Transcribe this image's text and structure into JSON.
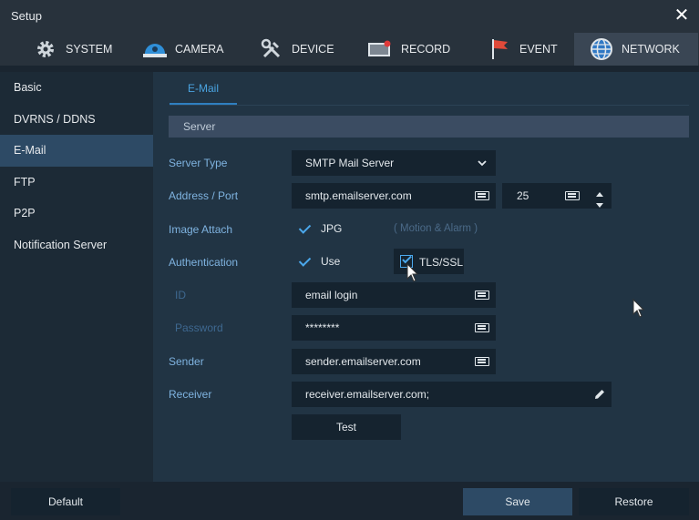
{
  "window": {
    "title": "Setup",
    "close_glyph": "✕"
  },
  "tabs": [
    {
      "label": "SYSTEM",
      "icon": "gear-icon"
    },
    {
      "label": "CAMERA",
      "icon": "camera-icon"
    },
    {
      "label": "DEVICE",
      "icon": "tools-icon"
    },
    {
      "label": "RECORD",
      "icon": "record-icon"
    },
    {
      "label": "EVENT",
      "icon": "flag-icon"
    },
    {
      "label": "NETWORK",
      "icon": "globe-icon"
    }
  ],
  "sidebar": {
    "items": [
      {
        "label": "Basic"
      },
      {
        "label": "DVRNS / DDNS"
      },
      {
        "label": "E-Mail"
      },
      {
        "label": "FTP"
      },
      {
        "label": "P2P"
      },
      {
        "label": "Notification Server"
      }
    ]
  },
  "subtab": {
    "label": "E-Mail"
  },
  "section": {
    "title": "Server"
  },
  "form": {
    "server_type": {
      "label": "Server Type",
      "value": "SMTP Mail Server"
    },
    "address_port": {
      "label": "Address / Port",
      "address": "smtp.emailserver.com",
      "port": "25"
    },
    "image_attach": {
      "label": "Image Attach",
      "option": "JPG",
      "note": "( Motion & Alarm )"
    },
    "authentication": {
      "label": "Authentication",
      "use": "Use",
      "tls": "TLS/SSL"
    },
    "id": {
      "label": "ID",
      "value": "email login"
    },
    "password": {
      "label": "Password",
      "value": "********"
    },
    "sender": {
      "label": "Sender",
      "value": "sender.emailserver.com"
    },
    "receiver": {
      "label": "Receiver",
      "value": "receiver.emailserver.com;"
    },
    "test_button": "Test"
  },
  "footer": {
    "default": "Default",
    "save": "Save",
    "restore": "Restore"
  },
  "colors": {
    "accent": "#4aa3e0",
    "active_tab": "#3a4654",
    "save_button": "#2d4a65"
  }
}
